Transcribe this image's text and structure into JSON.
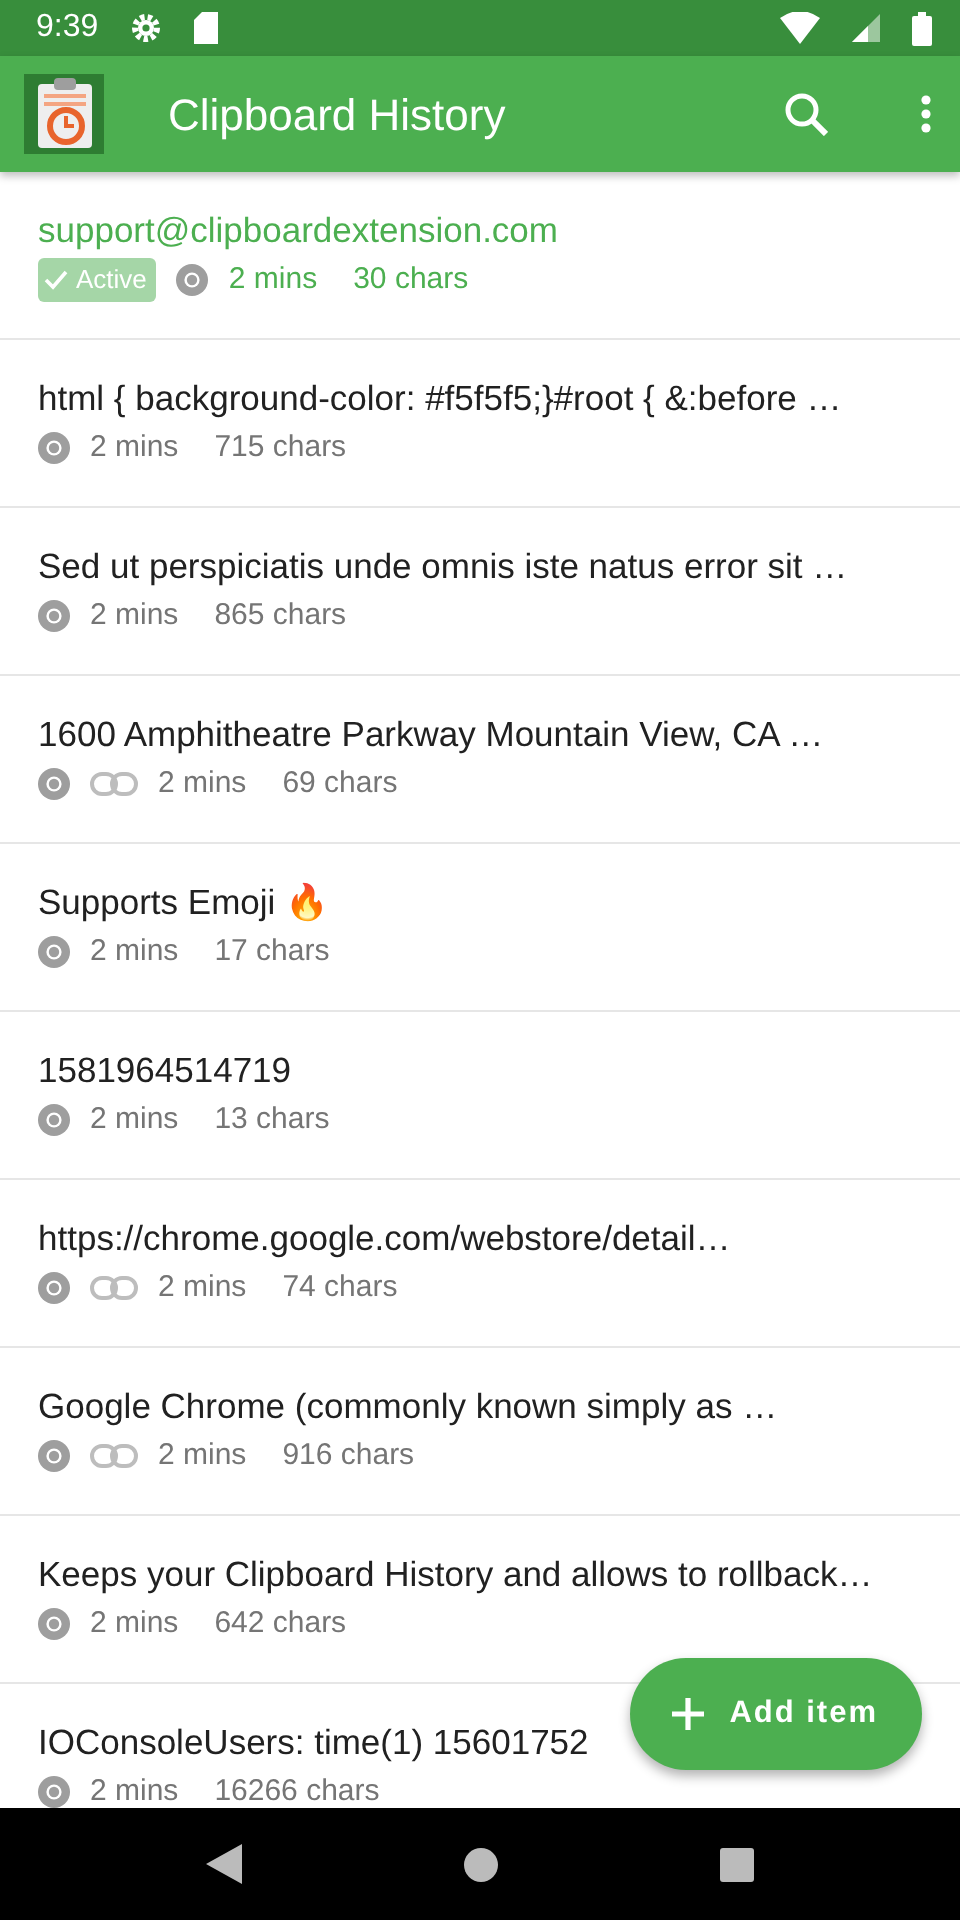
{
  "status_bar": {
    "time": "9:39"
  },
  "app_bar": {
    "title": "Clipboard History"
  },
  "items": [
    {
      "text": "support@clipboardextension.com",
      "active": true,
      "active_label": "Active",
      "link": false,
      "time": "2 mins",
      "chars": "30 chars"
    },
    {
      "text": "html { background-color: #f5f5f5;}#root { &:before …",
      "active": false,
      "link": false,
      "time": "2 mins",
      "chars": "715 chars"
    },
    {
      "text": "Sed ut perspiciatis unde omnis iste natus error sit …",
      "active": false,
      "link": false,
      "time": "2 mins",
      "chars": "865 chars"
    },
    {
      "text": "1600 Amphitheatre Parkway Mountain View, CA …",
      "active": false,
      "link": true,
      "time": "2 mins",
      "chars": "69 chars"
    },
    {
      "text": "Supports Emoji 🔥",
      "active": false,
      "link": false,
      "time": "2 mins",
      "chars": "17 chars"
    },
    {
      "text": "1581964514719",
      "active": false,
      "link": false,
      "time": "2 mins",
      "chars": "13 chars"
    },
    {
      "text": "https://chrome.google.com/webstore/detail…",
      "active": false,
      "link": true,
      "time": "2 mins",
      "chars": "74 chars"
    },
    {
      "text": "Google Chrome (commonly known simply as …",
      "active": false,
      "link": true,
      "time": "2 mins",
      "chars": "916 chars"
    },
    {
      "text": "Keeps your Clipboard History and allows to rollback…",
      "active": false,
      "link": false,
      "time": "2 mins",
      "chars": "642 chars"
    },
    {
      "text": "IOConsoleUsers: time(1) 15601752",
      "active": false,
      "link": false,
      "time": "2 mins",
      "chars": "16266 chars"
    }
  ],
  "fab": {
    "label": "Add item"
  }
}
